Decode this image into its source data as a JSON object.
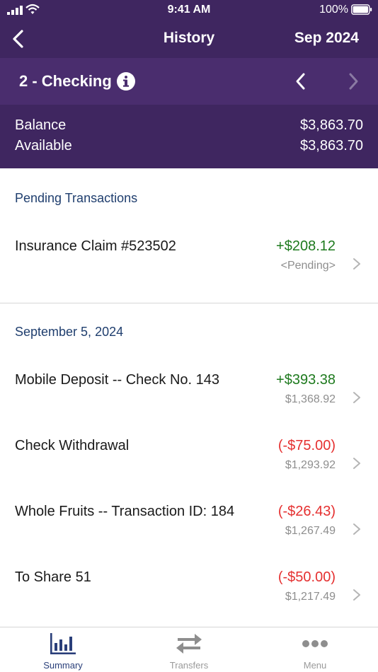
{
  "status_bar": {
    "time": "9:41 AM",
    "battery": "100%"
  },
  "nav": {
    "title": "History",
    "period": "Sep 2024"
  },
  "account": {
    "name": "2 - Checking"
  },
  "balances": [
    {
      "label": "Balance",
      "value": "$3,863.70"
    },
    {
      "label": "Available",
      "value": "$3,863.70"
    }
  ],
  "sections": [
    {
      "title": "Pending Transactions",
      "transactions": [
        {
          "description": "Insurance Claim #523502",
          "amount": "+$208.12",
          "sub": "<Pending>"
        }
      ]
    },
    {
      "title": "September 5, 2024",
      "transactions": [
        {
          "description": "Mobile Deposit -- Check No. 143",
          "amount": "+$393.38",
          "sub": "$1,368.92"
        },
        {
          "description": "Check Withdrawal",
          "amount": "(-$75.00)",
          "sub": "$1,293.92"
        },
        {
          "description": "Whole Fruits -- Transaction ID: 184",
          "amount": "(-$26.43)",
          "sub": "$1,267.49"
        },
        {
          "description": "To Share 51",
          "amount": "(-$50.00)",
          "sub": "$1,217.49"
        }
      ]
    }
  ],
  "tabs": [
    {
      "label": "Summary",
      "icon": "bar-chart-icon"
    },
    {
      "label": "Transfers",
      "icon": "transfer-arrows-icon"
    },
    {
      "label": "Menu",
      "icon": "more-dots-icon"
    }
  ],
  "colors": {
    "header": "#3f2660",
    "positive": "#1e7a1e",
    "negative": "#e53030",
    "section_title": "#1f3e6e",
    "active_tab": "#2a3f7a"
  }
}
